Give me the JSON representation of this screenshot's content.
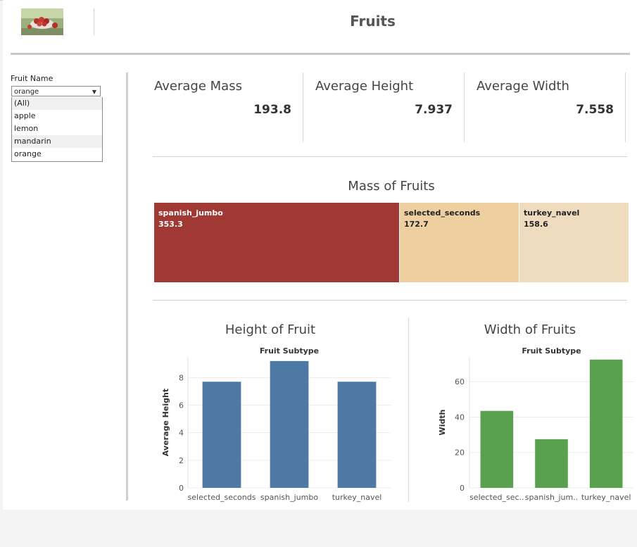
{
  "title": "Fruits",
  "filter": {
    "label": "Fruit Name",
    "selected": "orange",
    "options": [
      "(All)",
      "apple",
      "lemon",
      "mandarin",
      "orange"
    ]
  },
  "kpis": [
    {
      "label": "Average Mass",
      "value": "193.8"
    },
    {
      "label": "Average Height",
      "value": "7.937"
    },
    {
      "label": "Average Width",
      "value": "7.558"
    }
  ],
  "mass_chart": {
    "title": "Mass of Fruits",
    "cells": [
      {
        "name": "spanish_jumbo",
        "value": "353.3",
        "color": "#a03834",
        "text_color": "#ffffff"
      },
      {
        "name": "selected_seconds",
        "value": "172.7",
        "color": "#edcfa0",
        "text_color": "#222222"
      },
      {
        "name": "turkey_navel",
        "value": "158.6",
        "color": "#efdcbf",
        "text_color": "#222222"
      }
    ]
  },
  "height_chart_title": "Height of Fruit",
  "width_chart_title": "Width of Fruits",
  "chart_data": [
    {
      "type": "treemap",
      "title": "Mass of Fruits",
      "categories": [
        "spanish_jumbo",
        "selected_seconds",
        "turkey_navel"
      ],
      "values": [
        353.3,
        172.7,
        158.6
      ]
    },
    {
      "type": "bar",
      "title": "Height of Fruit",
      "xlabel": "Fruit Subtype",
      "ylabel": "Average Height",
      "categories": [
        "selected_seconds",
        "spanish_jumbo",
        "turkey_navel"
      ],
      "values": [
        7.7,
        9.2,
        7.7
      ],
      "yticks": [
        0,
        2,
        4,
        6,
        8
      ],
      "ylim": [
        0,
        9.5
      ],
      "color": "#4e79a7",
      "grid": true
    },
    {
      "type": "bar",
      "title": "Width of Fruits",
      "xlabel": "Fruit Subtype",
      "ylabel": "Width",
      "categories": [
        "selected_sec..",
        "spanish_jum..",
        "turkey_navel"
      ],
      "values": [
        43.5,
        27.5,
        72.5
      ],
      "yticks": [
        0,
        20,
        40,
        60
      ],
      "ylim": [
        0,
        74
      ],
      "color": "#59a14f",
      "grid": true
    }
  ]
}
